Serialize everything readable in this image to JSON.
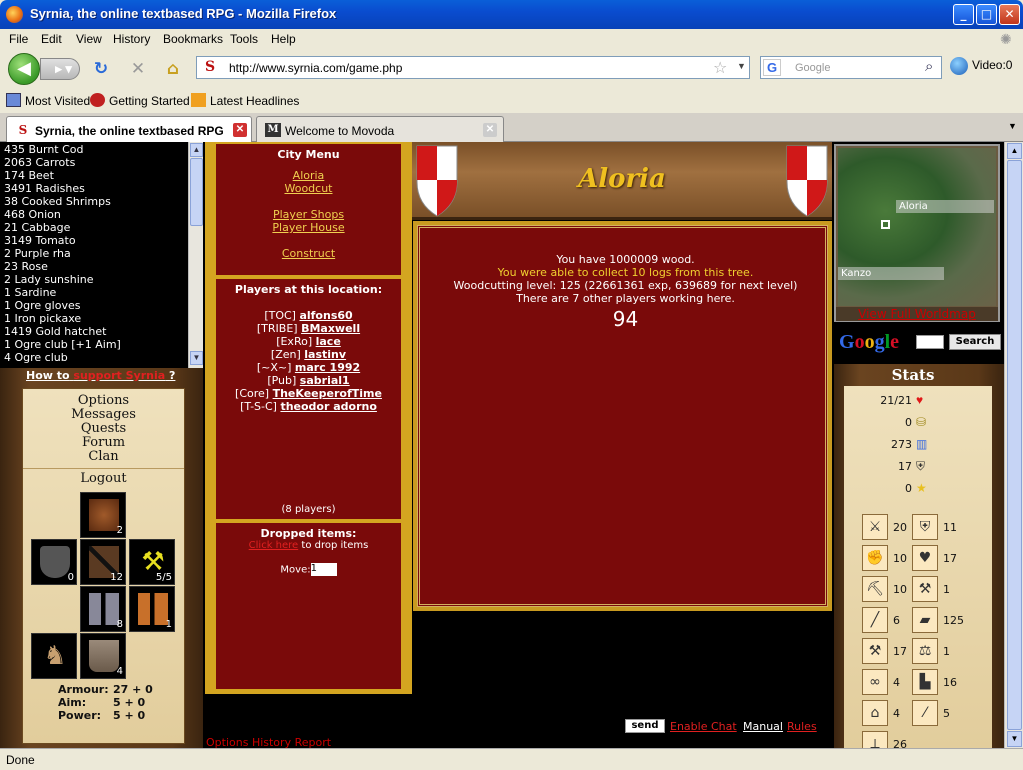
{
  "window": {
    "title": "Syrnia, the online textbased RPG - Mozilla Firefox"
  },
  "menu": [
    "File",
    "Edit",
    "View",
    "History",
    "Bookmarks",
    "Tools",
    "Help"
  ],
  "nav": {
    "url": "http://www.syrnia.com/game.php",
    "search_placeholder": "Google",
    "video_label": "Video:0"
  },
  "bookmarks": [
    "Most Visited",
    "Getting Started",
    "Latest Headlines"
  ],
  "tabs": [
    {
      "title": "Syrnia, the online textbased RPG"
    },
    {
      "title": "Welcome to Movoda"
    }
  ],
  "inventory": [
    "435 Burnt Cod",
    "2063 Carrots",
    "174 Beet",
    "3491 Radishes",
    "38 Cooked Shrimps",
    "468 Onion",
    "21 Cabbage",
    "3149 Tomato",
    "2 Purple rha",
    "23 Rose",
    "2 Lady sunshine",
    "1 Sardine",
    "1 Ogre gloves",
    "1 Iron pickaxe",
    "1419 Gold hatchet",
    "1 Ogre club [+1 Aim]",
    "4 Ogre club"
  ],
  "support": {
    "prefix": "How to",
    "link": "support Syrnia",
    "suffix": "?"
  },
  "left_nav": [
    "Options",
    "Messages",
    "Quests",
    "Forum",
    "Clan",
    "Logout"
  ],
  "equipment": {
    "helmet": "2",
    "shield": "0",
    "body": "12",
    "weapon": "5/5",
    "legs": "8",
    "gloves": "1",
    "horse": "",
    "boots": "4"
  },
  "armour": {
    "armour_label": "Armour:",
    "armour_value": "27 + 0",
    "aim_label": "Aim:",
    "aim_value": "5 + 0",
    "power_label": "Power:",
    "power_value": "5 + 0"
  },
  "city_menu": {
    "title": "City Menu",
    "links": [
      "Aloria",
      "Woodcut",
      "Player Shops",
      "Player House",
      "Construct"
    ]
  },
  "players": {
    "title": "Players at this location:",
    "list": [
      {
        "clan": "[TOC]",
        "name": "alfons60"
      },
      {
        "clan": "[TRIBE]",
        "name": "BMaxwell"
      },
      {
        "clan": "[ExRo]",
        "name": "lace"
      },
      {
        "clan": "[Zen]",
        "name": "lastinv"
      },
      {
        "clan": "[~X~]",
        "name": "marc 1992"
      },
      {
        "clan": "[Pub]",
        "name": "sabrial1"
      },
      {
        "clan": "[Core]",
        "name": "TheKeeperofTime"
      },
      {
        "clan": "[T-S-C]",
        "name": "theodor adorno"
      }
    ],
    "count": "(8 players)"
  },
  "dropped": {
    "title": "Dropped items:",
    "link": "Click here",
    "suffix": "to drop items",
    "move_label": "Move:",
    "move_value": "1"
  },
  "location": {
    "name": "Aloria"
  },
  "main": {
    "line1": "You have 1000009 wood.",
    "line2": "You were able to collect 10 logs from this tree.",
    "line3": "Woodcutting level: 125 (22661361 exp, 639689 for next level)",
    "line4": "There are 7 other players working here.",
    "counter": "94"
  },
  "chat": {
    "send": "send",
    "enable": "Enable Chat",
    "manual": "Manual",
    "rules": "Rules",
    "bottom": "Options History Report"
  },
  "map": {
    "label1": "Aloria",
    "label2": "Kanzo",
    "link": "View Full Worldmap"
  },
  "gsearch": {
    "button": "Search"
  },
  "stats": {
    "title": "Stats",
    "rows": [
      {
        "value": "21/21",
        "icon": "heart-icon"
      },
      {
        "value": "0",
        "icon": "gold-icon"
      },
      {
        "value": "273",
        "icon": "level-chart-icon"
      },
      {
        "value": "17",
        "icon": "shield-badge-icon"
      },
      {
        "value": "0",
        "icon": "star-icon"
      }
    ],
    "skills": [
      [
        "20",
        "11"
      ],
      [
        "10",
        "17"
      ],
      [
        "10",
        "1"
      ],
      [
        "6",
        "125"
      ],
      [
        "17",
        "1"
      ],
      [
        "4",
        "16"
      ],
      [
        "4",
        "5"
      ],
      [
        "26",
        ""
      ]
    ]
  },
  "status": "Done"
}
